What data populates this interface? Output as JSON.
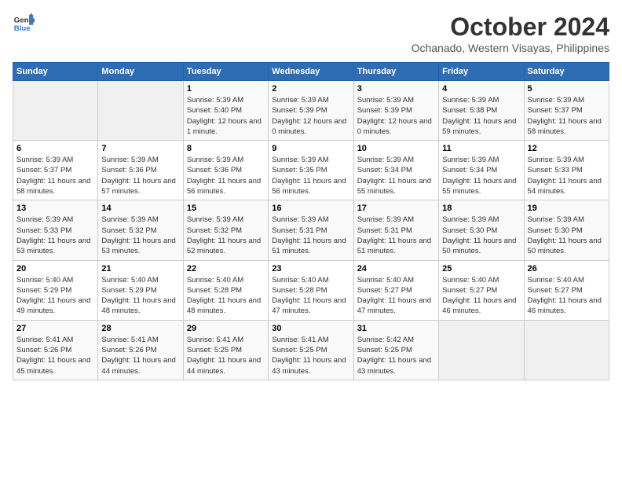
{
  "header": {
    "logo_line1": "General",
    "logo_line2": "Blue",
    "month": "October 2024",
    "location": "Ochanado, Western Visayas, Philippines"
  },
  "weekdays": [
    "Sunday",
    "Monday",
    "Tuesday",
    "Wednesday",
    "Thursday",
    "Friday",
    "Saturday"
  ],
  "weeks": [
    [
      {
        "day": "",
        "sunrise": "",
        "sunset": "",
        "daylight": ""
      },
      {
        "day": "",
        "sunrise": "",
        "sunset": "",
        "daylight": ""
      },
      {
        "day": "1",
        "sunrise": "Sunrise: 5:39 AM",
        "sunset": "Sunset: 5:40 PM",
        "daylight": "Daylight: 12 hours and 1 minute."
      },
      {
        "day": "2",
        "sunrise": "Sunrise: 5:39 AM",
        "sunset": "Sunset: 5:39 PM",
        "daylight": "Daylight: 12 hours and 0 minutes."
      },
      {
        "day": "3",
        "sunrise": "Sunrise: 5:39 AM",
        "sunset": "Sunset: 5:39 PM",
        "daylight": "Daylight: 12 hours and 0 minutes."
      },
      {
        "day": "4",
        "sunrise": "Sunrise: 5:39 AM",
        "sunset": "Sunset: 5:38 PM",
        "daylight": "Daylight: 11 hours and 59 minutes."
      },
      {
        "day": "5",
        "sunrise": "Sunrise: 5:39 AM",
        "sunset": "Sunset: 5:37 PM",
        "daylight": "Daylight: 11 hours and 58 minutes."
      }
    ],
    [
      {
        "day": "6",
        "sunrise": "Sunrise: 5:39 AM",
        "sunset": "Sunset: 5:37 PM",
        "daylight": "Daylight: 11 hours and 58 minutes."
      },
      {
        "day": "7",
        "sunrise": "Sunrise: 5:39 AM",
        "sunset": "Sunset: 5:36 PM",
        "daylight": "Daylight: 11 hours and 57 minutes."
      },
      {
        "day": "8",
        "sunrise": "Sunrise: 5:39 AM",
        "sunset": "Sunset: 5:36 PM",
        "daylight": "Daylight: 11 hours and 56 minutes."
      },
      {
        "day": "9",
        "sunrise": "Sunrise: 5:39 AM",
        "sunset": "Sunset: 5:35 PM",
        "daylight": "Daylight: 11 hours and 56 minutes."
      },
      {
        "day": "10",
        "sunrise": "Sunrise: 5:39 AM",
        "sunset": "Sunset: 5:34 PM",
        "daylight": "Daylight: 11 hours and 55 minutes."
      },
      {
        "day": "11",
        "sunrise": "Sunrise: 5:39 AM",
        "sunset": "Sunset: 5:34 PM",
        "daylight": "Daylight: 11 hours and 55 minutes."
      },
      {
        "day": "12",
        "sunrise": "Sunrise: 5:39 AM",
        "sunset": "Sunset: 5:33 PM",
        "daylight": "Daylight: 11 hours and 54 minutes."
      }
    ],
    [
      {
        "day": "13",
        "sunrise": "Sunrise: 5:39 AM",
        "sunset": "Sunset: 5:33 PM",
        "daylight": "Daylight: 11 hours and 53 minutes."
      },
      {
        "day": "14",
        "sunrise": "Sunrise: 5:39 AM",
        "sunset": "Sunset: 5:32 PM",
        "daylight": "Daylight: 11 hours and 53 minutes."
      },
      {
        "day": "15",
        "sunrise": "Sunrise: 5:39 AM",
        "sunset": "Sunset: 5:32 PM",
        "daylight": "Daylight: 11 hours and 52 minutes."
      },
      {
        "day": "16",
        "sunrise": "Sunrise: 5:39 AM",
        "sunset": "Sunset: 5:31 PM",
        "daylight": "Daylight: 11 hours and 51 minutes."
      },
      {
        "day": "17",
        "sunrise": "Sunrise: 5:39 AM",
        "sunset": "Sunset: 5:31 PM",
        "daylight": "Daylight: 11 hours and 51 minutes."
      },
      {
        "day": "18",
        "sunrise": "Sunrise: 5:39 AM",
        "sunset": "Sunset: 5:30 PM",
        "daylight": "Daylight: 11 hours and 50 minutes."
      },
      {
        "day": "19",
        "sunrise": "Sunrise: 5:39 AM",
        "sunset": "Sunset: 5:30 PM",
        "daylight": "Daylight: 11 hours and 50 minutes."
      }
    ],
    [
      {
        "day": "20",
        "sunrise": "Sunrise: 5:40 AM",
        "sunset": "Sunset: 5:29 PM",
        "daylight": "Daylight: 11 hours and 49 minutes."
      },
      {
        "day": "21",
        "sunrise": "Sunrise: 5:40 AM",
        "sunset": "Sunset: 5:29 PM",
        "daylight": "Daylight: 11 hours and 48 minutes."
      },
      {
        "day": "22",
        "sunrise": "Sunrise: 5:40 AM",
        "sunset": "Sunset: 5:28 PM",
        "daylight": "Daylight: 11 hours and 48 minutes."
      },
      {
        "day": "23",
        "sunrise": "Sunrise: 5:40 AM",
        "sunset": "Sunset: 5:28 PM",
        "daylight": "Daylight: 11 hours and 47 minutes."
      },
      {
        "day": "24",
        "sunrise": "Sunrise: 5:40 AM",
        "sunset": "Sunset: 5:27 PM",
        "daylight": "Daylight: 11 hours and 47 minutes."
      },
      {
        "day": "25",
        "sunrise": "Sunrise: 5:40 AM",
        "sunset": "Sunset: 5:27 PM",
        "daylight": "Daylight: 11 hours and 46 minutes."
      },
      {
        "day": "26",
        "sunrise": "Sunrise: 5:40 AM",
        "sunset": "Sunset: 5:27 PM",
        "daylight": "Daylight: 11 hours and 46 minutes."
      }
    ],
    [
      {
        "day": "27",
        "sunrise": "Sunrise: 5:41 AM",
        "sunset": "Sunset: 5:26 PM",
        "daylight": "Daylight: 11 hours and 45 minutes."
      },
      {
        "day": "28",
        "sunrise": "Sunrise: 5:41 AM",
        "sunset": "Sunset: 5:26 PM",
        "daylight": "Daylight: 11 hours and 44 minutes."
      },
      {
        "day": "29",
        "sunrise": "Sunrise: 5:41 AM",
        "sunset": "Sunset: 5:25 PM",
        "daylight": "Daylight: 11 hours and 44 minutes."
      },
      {
        "day": "30",
        "sunrise": "Sunrise: 5:41 AM",
        "sunset": "Sunset: 5:25 PM",
        "daylight": "Daylight: 11 hours and 43 minutes."
      },
      {
        "day": "31",
        "sunrise": "Sunrise: 5:42 AM",
        "sunset": "Sunset: 5:25 PM",
        "daylight": "Daylight: 11 hours and 43 minutes."
      },
      {
        "day": "",
        "sunrise": "",
        "sunset": "",
        "daylight": ""
      },
      {
        "day": "",
        "sunrise": "",
        "sunset": "",
        "daylight": ""
      }
    ]
  ]
}
